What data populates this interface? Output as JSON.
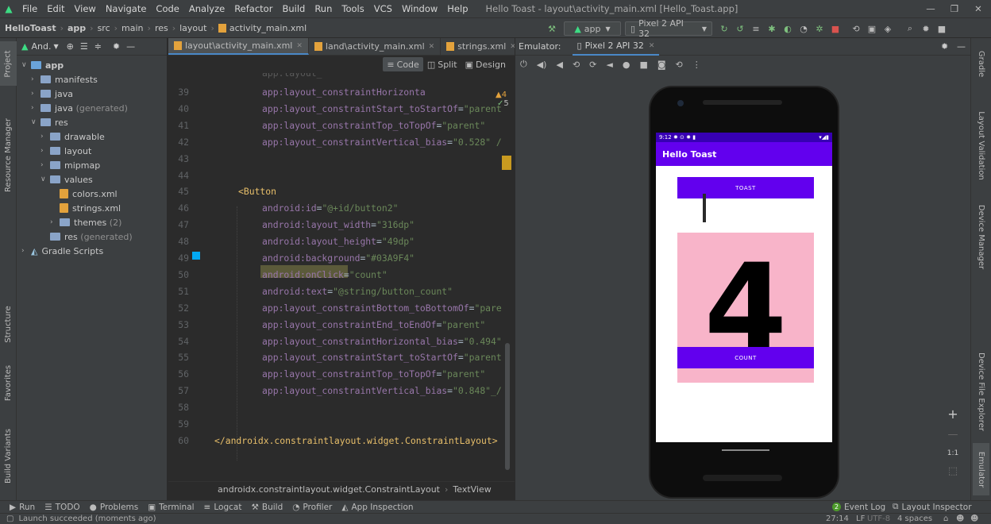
{
  "menubar": {
    "items": [
      "File",
      "Edit",
      "View",
      "Navigate",
      "Code",
      "Analyze",
      "Refactor",
      "Build",
      "Run",
      "Tools",
      "VCS",
      "Window",
      "Help"
    ],
    "window_title": "Hello Toast - layout\\activity_main.xml [Hello_Toast.app]"
  },
  "breadcrumb": [
    "HelloToast",
    "app",
    "src",
    "main",
    "res",
    "layout",
    "activity_main.xml"
  ],
  "toolbar": {
    "run_config": "app",
    "device": "Pixel 2 API 32"
  },
  "project": {
    "view_label": "And.",
    "tree": [
      {
        "label": "app",
        "type": "module"
      },
      {
        "label": "manifests",
        "type": "folder"
      },
      {
        "label": "java",
        "type": "folder"
      },
      {
        "label": "java",
        "suffix": "(generated)",
        "type": "folder"
      },
      {
        "label": "res",
        "type": "folder"
      },
      {
        "label": "drawable",
        "type": "folder"
      },
      {
        "label": "layout",
        "type": "folder"
      },
      {
        "label": "mipmap",
        "type": "folder"
      },
      {
        "label": "values",
        "type": "folder"
      },
      {
        "label": "colors.xml",
        "type": "xml"
      },
      {
        "label": "strings.xml",
        "type": "xml"
      },
      {
        "label": "themes",
        "suffix": "(2)",
        "type": "folder"
      },
      {
        "label": "res",
        "suffix": "(generated)",
        "type": "folder"
      },
      {
        "label": "Gradle Scripts",
        "type": "gradle"
      }
    ]
  },
  "left_tool_tabs": [
    "Project",
    "Resource Manager",
    "Structure",
    "Favorites",
    "Build Variants"
  ],
  "right_tool_tabs": [
    "Gradle",
    "Layout Validation",
    "Device Manager",
    "Device File Explorer",
    "Emulator"
  ],
  "editor": {
    "tabs": [
      "layout\\activity_main.xml",
      "land\\activity_main.xml",
      "strings.xml"
    ],
    "modes": [
      "Code",
      "Split",
      "Design"
    ],
    "inspection": {
      "warnings": "4",
      "ok": "5"
    },
    "lines": [
      {
        "n": "39",
        "code": "app:layout_constraintHorizonta"
      },
      {
        "n": "40",
        "code": "app:layout_constraintStart_toStartOf=\"parent"
      },
      {
        "n": "41",
        "code": "app:layout_constraintTop_toTopOf=\"parent\""
      },
      {
        "n": "42",
        "code": "app:layout_constraintVertical_bias=\"0.528\" /"
      },
      {
        "n": "43",
        "code": ""
      },
      {
        "n": "44",
        "code": ""
      },
      {
        "n": "45",
        "code": "<Button"
      },
      {
        "n": "46",
        "code": "android:id=\"@+id/button2\""
      },
      {
        "n": "47",
        "code": "android:layout_width=\"316dp\""
      },
      {
        "n": "48",
        "code": "android:layout_height=\"49dp\""
      },
      {
        "n": "49",
        "code": "android:background=\"#03A9F4\""
      },
      {
        "n": "50",
        "code": "android:onClick=\"count\""
      },
      {
        "n": "51",
        "code": "android:text=\"@string/button_count\""
      },
      {
        "n": "52",
        "code": "app:layout_constraintBottom_toBottomOf=\"pare"
      },
      {
        "n": "53",
        "code": "app:layout_constraintEnd_toEndOf=\"parent\""
      },
      {
        "n": "54",
        "code": "app:layout_constraintHorizontal_bias=\"0.494\""
      },
      {
        "n": "55",
        "code": "app:layout_constraintStart_toStartOf=\"parent"
      },
      {
        "n": "56",
        "code": "app:layout_constraintTop_toTopOf=\"parent\""
      },
      {
        "n": "57",
        "code": "app:layout_constraintVertical_bias=\"0.848\"_/"
      },
      {
        "n": "58",
        "code": ""
      },
      {
        "n": "59",
        "code": ""
      },
      {
        "n": "60",
        "code": "</androidx.constraintlayout.widget.ConstraintLayout>"
      }
    ],
    "footer_path": [
      "androidx.constraintlayout.widget.ConstraintLayout",
      "TextView"
    ]
  },
  "emulator": {
    "label": "Emulator:",
    "device_tab": "Pixel 2 API 32",
    "status_time": "9:12",
    "app_title": "Hello Toast",
    "toast_button": "TOAST",
    "count_button": "COUNT",
    "count_value": "4",
    "zoom_label": "1:1"
  },
  "bottom_tools": [
    "Run",
    "TODO",
    "Problems",
    "Terminal",
    "Logcat",
    "Build",
    "Profiler",
    "App Inspection"
  ],
  "bottom_right_tools": {
    "event_log": "Event Log",
    "event_count": "2",
    "layout_inspector": "Layout Inspector"
  },
  "status": {
    "message": "Launch succeeded (moments ago)",
    "position": "27:14",
    "line_sep": "LF",
    "encoding": "UTF-8",
    "indent": "4 spaces"
  }
}
